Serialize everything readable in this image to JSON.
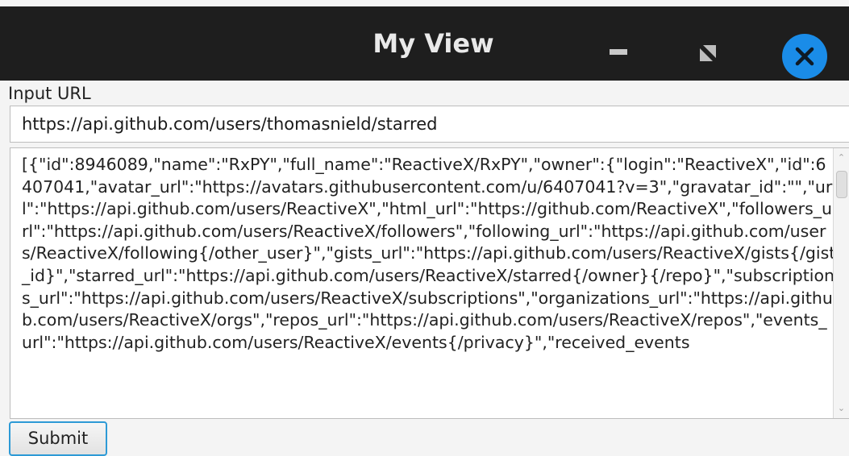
{
  "window": {
    "title": "My View"
  },
  "form": {
    "input_label": "Input URL",
    "url_value": "https://api.github.com/users/thomasnield/starred",
    "response_text": "[{\"id\":8946089,\"name\":\"RxPY\",\"full_name\":\"ReactiveX/RxPY\",\"owner\":{\"login\":\"ReactiveX\",\"id\":6407041,\"avatar_url\":\"https://avatars.githubusercontent.com/u/6407041?v=3\",\"gravatar_id\":\"\",\"url\":\"https://api.github.com/users/ReactiveX\",\"html_url\":\"https://github.com/ReactiveX\",\"followers_url\":\"https://api.github.com/users/ReactiveX/followers\",\"following_url\":\"https://api.github.com/users/ReactiveX/following{/other_user}\",\"gists_url\":\"https://api.github.com/users/ReactiveX/gists{/gist_id}\",\"starred_url\":\"https://api.github.com/users/ReactiveX/starred{/owner}{/repo}\",\"subscriptions_url\":\"https://api.github.com/users/ReactiveX/subscriptions\",\"organizations_url\":\"https://api.github.com/users/ReactiveX/orgs\",\"repos_url\":\"https://api.github.com/users/ReactiveX/repos\",\"events_url\":\"https://api.github.com/users/ReactiveX/events{/privacy}\",\"received_events",
    "submit_label": "Submit"
  },
  "icons": {
    "minimize": "minimize-icon",
    "maximize": "maximize-icon",
    "close": "close-icon"
  },
  "colors": {
    "titlebar": "#1e1e1e",
    "close_button": "#1a8ce8",
    "submit_border": "#2d9ad6"
  }
}
